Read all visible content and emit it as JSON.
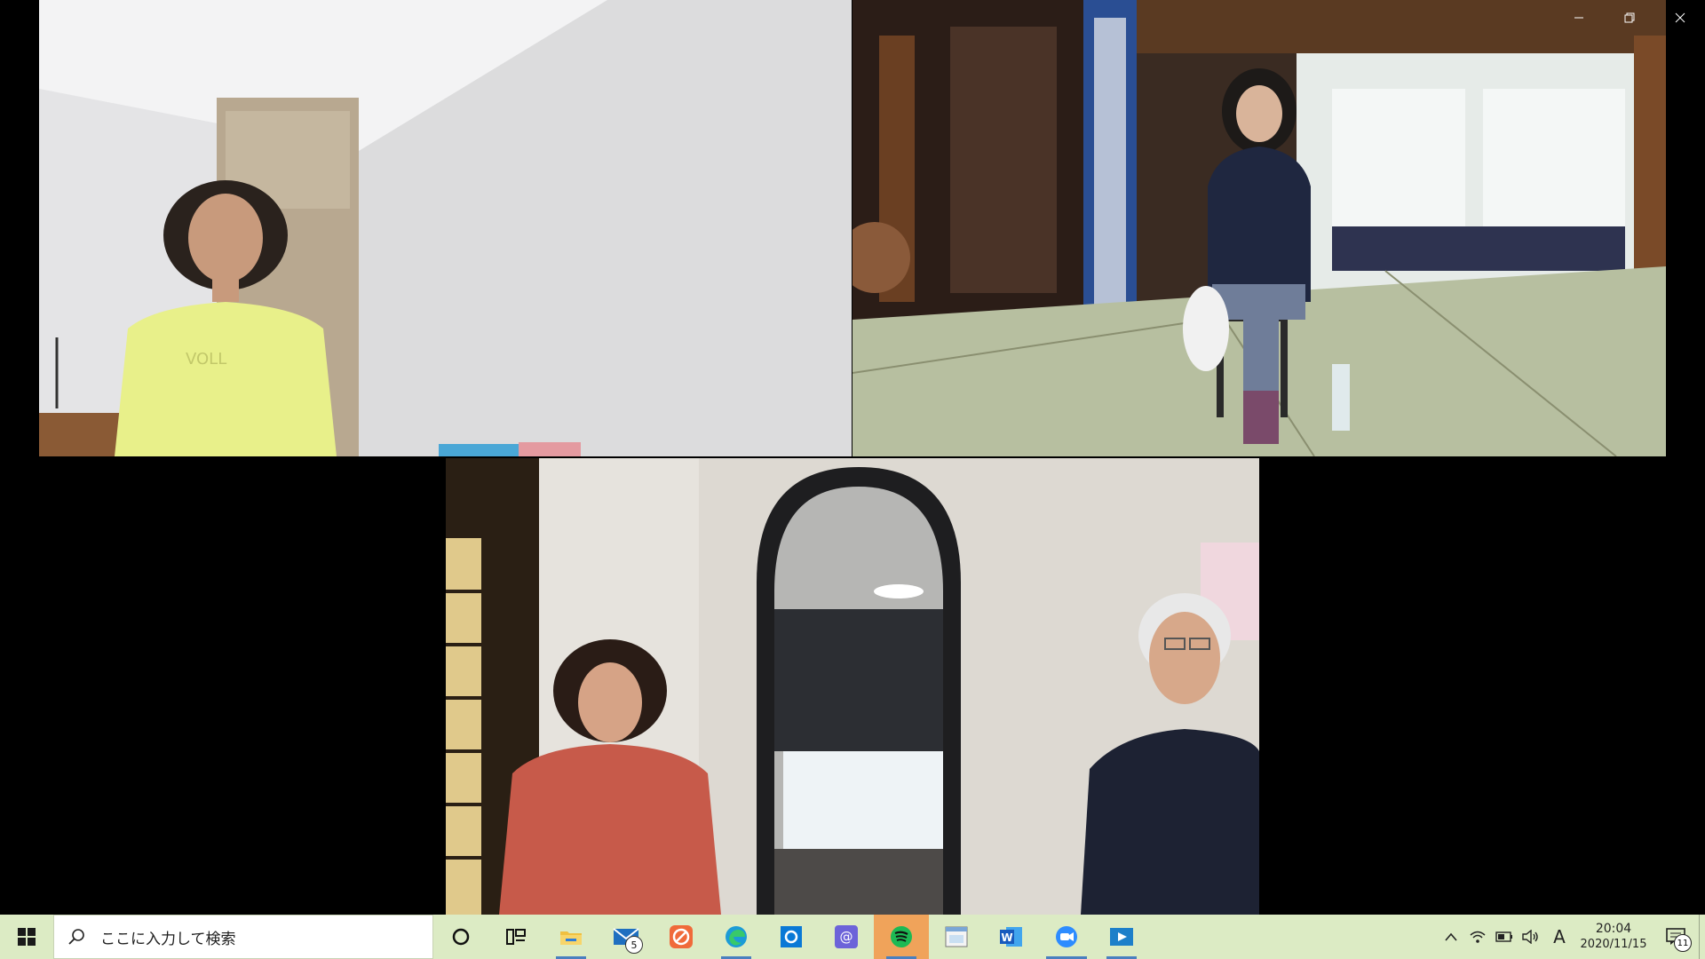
{
  "window_controls": {
    "minimize": "minimize",
    "restore": "restore",
    "close": "close"
  },
  "participants": [
    {
      "id": "tile1",
      "scene": "woman in yellow t-shirt in a white room"
    },
    {
      "id": "tile2",
      "scene": "instructor seated on chair in temple hall"
    },
    {
      "id": "tile3",
      "scene": "elderly couple in front of arched doorway"
    }
  ],
  "taskbar": {
    "search_placeholder": "ここに入力して検索",
    "apps": [
      {
        "name": "cortana",
        "icon": "circle-icon"
      },
      {
        "name": "task-view",
        "icon": "task-view-icon"
      },
      {
        "name": "file-explorer",
        "icon": "folder-icon"
      },
      {
        "name": "mail",
        "icon": "mail-icon",
        "badge": "5"
      },
      {
        "name": "app-orange",
        "icon": "orange-app-icon"
      },
      {
        "name": "edge",
        "icon": "edge-icon"
      },
      {
        "name": "outlook",
        "icon": "outlook-icon"
      },
      {
        "name": "menu-mail",
        "icon": "at-mail-icon"
      },
      {
        "name": "spotify",
        "icon": "spotify-icon"
      },
      {
        "name": "window-app",
        "icon": "window-app-icon"
      },
      {
        "name": "word",
        "icon": "word-icon"
      },
      {
        "name": "zoom",
        "icon": "zoom-icon"
      },
      {
        "name": "media",
        "icon": "media-icon"
      }
    ],
    "ime": "A",
    "time": "20:04",
    "date": "2020/11/15",
    "notification_count": "11"
  },
  "colors": {
    "taskbar_bg": "#dcebc4",
    "accent": "#4a7fbf"
  }
}
